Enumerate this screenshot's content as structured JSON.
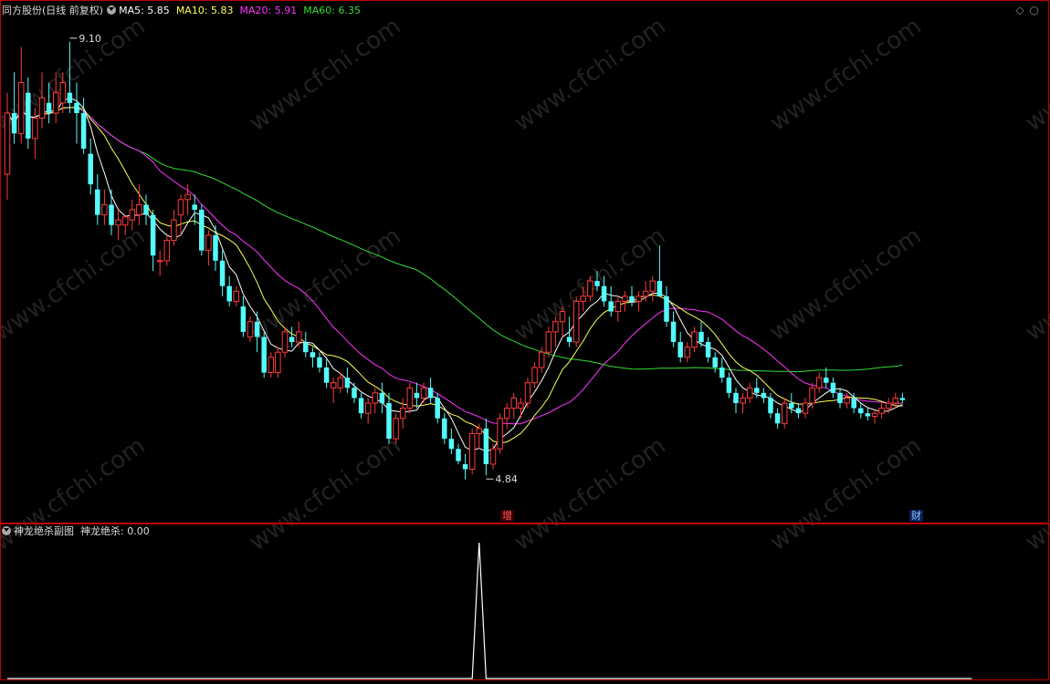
{
  "header": {
    "stock_name": "同方股份(日线 前复权)",
    "ma5": "MA5: 5.85",
    "ma10": "MA10: 5.83",
    "ma20": "MA20: 5.91",
    "ma60": "MA60: 6.35"
  },
  "sub_header": {
    "indicator_name": "神龙绝杀副图",
    "value_label": "神龙绝杀: 0.00"
  },
  "window_controls": {
    "restore": "◇",
    "close": "○"
  },
  "markers": {
    "zeng": "增",
    "cai": "财"
  },
  "colors": {
    "up": "#ff3b3b",
    "down": "#54fcfc",
    "ma5": "#ffffff",
    "ma10": "#ffff55",
    "ma20": "#ff33ff",
    "ma60": "#33dd33",
    "border": "#c00000",
    "indicator": "#ffffff",
    "watermark": "#222222"
  },
  "watermark": "www.cfchi.com",
  "chart_data": [
    {
      "type": "candlestick",
      "ylim": [
        4.6,
        9.35
      ],
      "annotations": [
        {
          "text": "9.10",
          "index": 9,
          "price": 9.1,
          "side": "high"
        },
        {
          "text": "4.84",
          "index": 69,
          "price": 4.84,
          "side": "low"
        }
      ],
      "ohlc": [
        [
          7.8,
          8.6,
          7.55,
          8.4
        ],
        [
          8.4,
          8.8,
          8.1,
          8.2
        ],
        [
          8.2,
          9.05,
          8.1,
          8.7
        ],
        [
          8.6,
          8.75,
          8.05,
          8.15
        ],
        [
          8.15,
          8.45,
          7.95,
          8.35
        ],
        [
          8.35,
          8.8,
          8.25,
          8.55
        ],
        [
          8.5,
          8.7,
          8.3,
          8.4
        ],
        [
          8.4,
          8.8,
          8.3,
          8.6
        ],
        [
          8.5,
          8.8,
          8.4,
          8.7
        ],
        [
          8.6,
          9.1,
          8.4,
          8.5
        ],
        [
          8.5,
          8.7,
          8.1,
          8.4
        ],
        [
          8.4,
          8.55,
          8.0,
          8.05
        ],
        [
          8.0,
          8.15,
          7.6,
          7.7
        ],
        [
          7.65,
          7.8,
          7.3,
          7.4
        ],
        [
          7.4,
          7.65,
          7.3,
          7.5
        ],
        [
          7.5,
          7.65,
          7.2,
          7.3
        ],
        [
          7.3,
          7.45,
          7.15,
          7.35
        ],
        [
          7.3,
          7.4,
          7.2,
          7.38
        ],
        [
          7.35,
          7.55,
          7.25,
          7.45
        ],
        [
          7.4,
          7.7,
          7.3,
          7.5
        ],
        [
          7.5,
          7.6,
          7.3,
          7.4
        ],
        [
          7.4,
          7.45,
          6.85,
          7.0
        ],
        [
          6.95,
          7.05,
          6.8,
          6.95
        ],
        [
          6.95,
          7.2,
          6.9,
          7.15
        ],
        [
          7.15,
          7.45,
          7.1,
          7.35
        ],
        [
          7.4,
          7.6,
          7.2,
          7.55
        ],
        [
          7.55,
          7.7,
          7.4,
          7.6
        ],
        [
          7.5,
          7.6,
          7.3,
          7.45
        ],
        [
          7.45,
          7.5,
          7.0,
          7.05
        ],
        [
          7.05,
          7.25,
          6.9,
          7.2
        ],
        [
          7.2,
          7.3,
          6.85,
          6.95
        ],
        [
          6.95,
          7.05,
          6.6,
          6.7
        ],
        [
          6.7,
          6.8,
          6.5,
          6.55
        ],
        [
          6.55,
          6.7,
          6.5,
          6.65
        ],
        [
          6.5,
          6.6,
          6.2,
          6.25
        ],
        [
          6.2,
          6.4,
          6.15,
          6.35
        ],
        [
          6.35,
          6.45,
          6.05,
          6.2
        ],
        [
          6.2,
          6.25,
          5.8,
          5.85
        ],
        [
          5.85,
          6.05,
          5.8,
          6.0
        ],
        [
          5.85,
          6.1,
          5.8,
          6.05
        ],
        [
          6.05,
          6.3,
          6.0,
          6.25
        ],
        [
          6.2,
          6.3,
          6.1,
          6.15
        ],
        [
          6.15,
          6.35,
          6.1,
          6.25
        ],
        [
          6.15,
          6.25,
          6.0,
          6.05
        ],
        [
          6.05,
          6.1,
          5.9,
          6.0
        ],
        [
          6.0,
          6.05,
          5.85,
          5.9
        ],
        [
          5.9,
          6.0,
          5.7,
          5.75
        ],
        [
          5.7,
          5.8,
          5.55,
          5.75
        ],
        [
          5.7,
          5.85,
          5.65,
          5.8
        ],
        [
          5.8,
          5.9,
          5.65,
          5.7
        ],
        [
          5.7,
          5.75,
          5.55,
          5.6
        ],
        [
          5.6,
          5.65,
          5.4,
          5.45
        ],
        [
          5.45,
          5.6,
          5.35,
          5.55
        ],
        [
          5.55,
          5.7,
          5.45,
          5.65
        ],
        [
          5.65,
          5.75,
          5.45,
          5.55
        ],
        [
          5.55,
          5.65,
          5.15,
          5.2
        ],
        [
          5.2,
          5.45,
          5.15,
          5.4
        ],
        [
          5.4,
          5.6,
          5.3,
          5.5
        ],
        [
          5.5,
          5.75,
          5.45,
          5.7
        ],
        [
          5.65,
          5.75,
          5.5,
          5.6
        ],
        [
          5.6,
          5.75,
          5.55,
          5.7
        ],
        [
          5.7,
          5.8,
          5.55,
          5.6
        ],
        [
          5.6,
          5.65,
          5.35,
          5.4
        ],
        [
          5.4,
          5.45,
          5.15,
          5.2
        ],
        [
          5.2,
          5.3,
          5.05,
          5.1
        ],
        [
          5.1,
          5.15,
          4.95,
          4.98
        ],
        [
          4.95,
          5.05,
          4.8,
          4.9
        ],
        [
          4.9,
          5.3,
          4.85,
          5.25
        ],
        [
          5.25,
          5.35,
          5.1,
          5.3
        ],
        [
          5.3,
          5.4,
          4.84,
          4.95
        ],
        [
          4.95,
          5.15,
          4.9,
          5.1
        ],
        [
          5.1,
          5.45,
          5.05,
          5.4
        ],
        [
          5.4,
          5.55,
          5.3,
          5.5
        ],
        [
          5.5,
          5.65,
          5.4,
          5.6
        ],
        [
          5.5,
          5.6,
          5.4,
          5.55
        ],
        [
          5.55,
          5.8,
          5.5,
          5.75
        ],
        [
          5.75,
          5.95,
          5.7,
          5.9
        ],
        [
          5.9,
          6.1,
          5.85,
          6.05
        ],
        [
          6.05,
          6.3,
          6.0,
          6.25
        ],
        [
          6.25,
          6.4,
          6.1,
          6.35
        ],
        [
          6.35,
          6.5,
          6.2,
          6.45
        ],
        [
          6.2,
          6.4,
          6.1,
          6.15
        ],
        [
          6.15,
          6.6,
          6.1,
          6.55
        ],
        [
          6.55,
          6.7,
          6.45,
          6.6
        ],
        [
          6.6,
          6.8,
          6.55,
          6.75
        ],
        [
          6.75,
          6.85,
          6.65,
          6.7
        ],
        [
          6.7,
          6.8,
          6.5,
          6.55
        ],
        [
          6.55,
          6.7,
          6.4,
          6.45
        ],
        [
          6.45,
          6.6,
          6.35,
          6.55
        ],
        [
          6.55,
          6.65,
          6.45,
          6.6
        ],
        [
          6.6,
          6.7,
          6.5,
          6.55
        ],
        [
          6.55,
          6.65,
          6.45,
          6.6
        ],
        [
          6.6,
          6.75,
          6.55,
          6.65
        ],
        [
          6.65,
          6.8,
          6.55,
          6.75
        ],
        [
          6.75,
          7.1,
          6.65,
          6.6
        ],
        [
          6.6,
          6.7,
          6.3,
          6.35
        ],
        [
          6.35,
          6.45,
          6.1,
          6.15
        ],
        [
          6.15,
          6.25,
          5.95,
          6.0
        ],
        [
          6.0,
          6.15,
          5.95,
          6.1
        ],
        [
          6.1,
          6.3,
          6.05,
          6.25
        ],
        [
          6.25,
          6.35,
          6.1,
          6.15
        ],
        [
          6.15,
          6.2,
          5.95,
          6.0
        ],
        [
          6.0,
          6.05,
          5.85,
          5.9
        ],
        [
          5.9,
          6.0,
          5.75,
          5.8
        ],
        [
          5.8,
          5.85,
          5.6,
          5.65
        ],
        [
          5.65,
          5.7,
          5.45,
          5.55
        ],
        [
          5.55,
          5.65,
          5.45,
          5.6
        ],
        [
          5.6,
          5.75,
          5.55,
          5.7
        ],
        [
          5.7,
          5.8,
          5.6,
          5.65
        ],
        [
          5.65,
          5.7,
          5.55,
          5.6
        ],
        [
          5.6,
          5.65,
          5.4,
          5.45
        ],
        [
          5.45,
          5.5,
          5.3,
          5.35
        ],
        [
          5.35,
          5.6,
          5.3,
          5.55
        ],
        [
          5.55,
          5.65,
          5.45,
          5.5
        ],
        [
          5.5,
          5.55,
          5.4,
          5.45
        ],
        [
          5.45,
          5.6,
          5.4,
          5.55
        ],
        [
          5.55,
          5.75,
          5.5,
          5.7
        ],
        [
          5.7,
          5.85,
          5.65,
          5.8
        ],
        [
          5.8,
          5.9,
          5.7,
          5.75
        ],
        [
          5.75,
          5.8,
          5.6,
          5.65
        ],
        [
          5.65,
          5.7,
          5.5,
          5.55
        ],
        [
          5.55,
          5.65,
          5.5,
          5.6
        ],
        [
          5.6,
          5.65,
          5.45,
          5.5
        ],
        [
          5.5,
          5.55,
          5.4,
          5.45
        ],
        [
          5.45,
          5.5,
          5.38,
          5.42
        ],
        [
          5.42,
          5.48,
          5.35,
          5.45
        ],
        [
          5.45,
          5.55,
          5.4,
          5.5
        ],
        [
          5.5,
          5.6,
          5.45,
          5.55
        ],
        [
          5.55,
          5.65,
          5.5,
          5.6
        ],
        [
          5.6,
          5.65,
          5.55,
          5.58
        ]
      ]
    },
    {
      "type": "line",
      "name": "神龙绝杀",
      "ylim": [
        0,
        1
      ],
      "values_by_index": [
        0,
        0,
        0,
        0,
        0,
        0,
        0,
        0,
        0,
        0,
        0,
        0,
        0,
        0,
        0,
        0,
        0,
        0,
        0,
        0,
        0,
        0,
        0,
        0,
        0,
        0,
        0,
        0,
        0,
        0,
        0,
        0,
        0,
        0,
        0,
        0,
        0,
        0,
        0,
        0,
        0,
        0,
        0,
        0,
        0,
        0,
        0,
        0,
        0,
        0,
        0,
        0,
        0,
        0,
        0,
        0,
        0,
        0,
        0,
        0,
        0,
        0,
        0,
        0,
        0,
        0,
        0,
        0,
        1,
        0,
        0,
        0,
        0,
        0,
        0,
        0,
        0,
        0,
        0,
        0,
        0,
        0,
        0,
        0,
        0,
        0,
        0,
        0,
        0,
        0,
        0,
        0,
        0,
        0,
        0,
        0,
        0,
        0,
        0,
        0,
        0,
        0,
        0,
        0,
        0,
        0,
        0,
        0,
        0,
        0,
        0,
        0,
        0,
        0,
        0,
        0,
        0,
        0,
        0,
        0,
        0,
        0,
        0,
        0,
        0,
        0,
        0,
        0,
        0,
        0,
        0,
        0,
        0,
        0,
        0,
        0,
        0,
        0,
        0,
        0
      ]
    }
  ]
}
